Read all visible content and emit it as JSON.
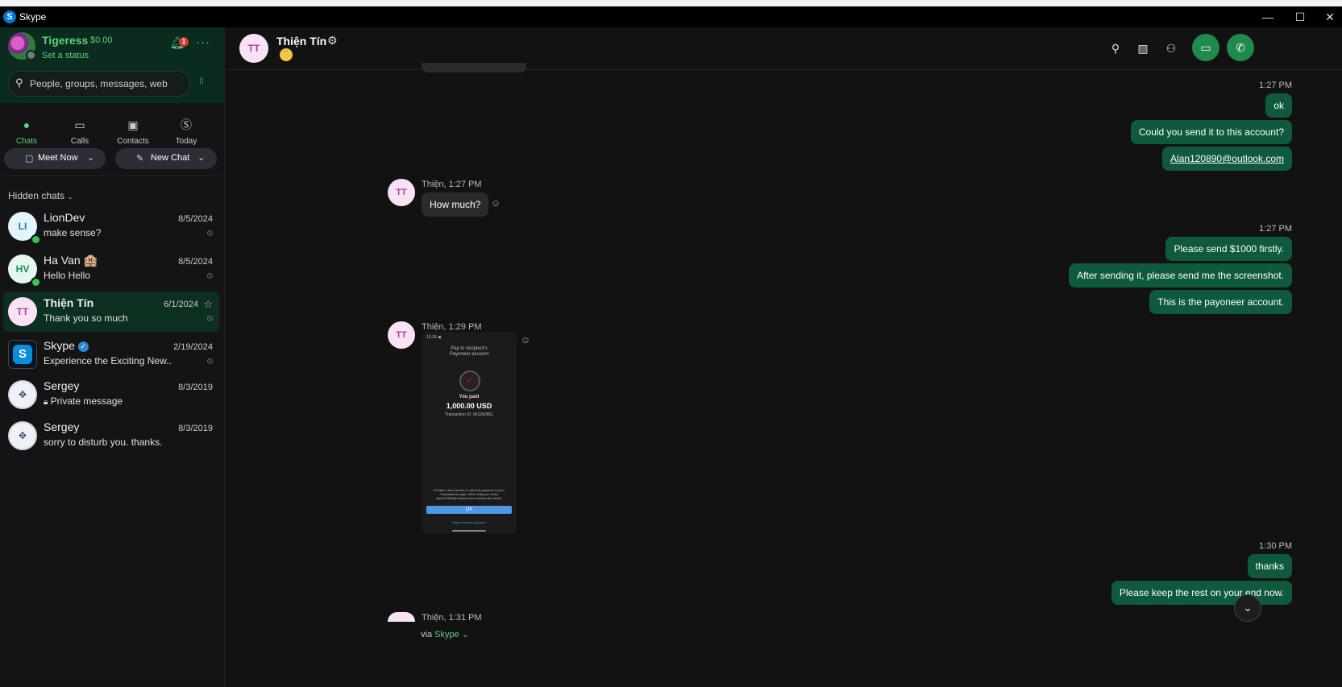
{
  "window": {
    "title": "Skype",
    "minimize": "—",
    "maximize": "☐",
    "close": "✕"
  },
  "profile": {
    "name": "Tigeress",
    "credit": "$0.00",
    "status": "Set a status",
    "notifications": "1"
  },
  "search": {
    "placeholder": "People, groups, messages, web"
  },
  "nav": {
    "chats": "Chats",
    "calls": "Calls",
    "contacts": "Contacts",
    "today": "Today"
  },
  "actions": {
    "meet_now": "Meet Now",
    "new_chat": "New Chat"
  },
  "hidden_chats_label": "Hidden chats",
  "chats": [
    {
      "initials": "LI",
      "name": "LionDev",
      "preview": "make sense?",
      "date": "8/5/2024"
    },
    {
      "initials": "HV",
      "name": "Ha Van 🏨",
      "preview": "Hello Hello",
      "date": "8/5/2024"
    },
    {
      "initials": "TT",
      "name": "Thiện Tín",
      "preview": "Thank you so much",
      "date": "6/1/2024"
    },
    {
      "initials": "S",
      "name": "Skype",
      "preview": "Experience the Exciting New...",
      "date": "2/19/2024"
    },
    {
      "initials": "",
      "name": "Sergey",
      "preview": "Private message",
      "date": "8/3/2019"
    },
    {
      "initials": "",
      "name": "Sergey",
      "preview": "sorry to disturb you. thanks.",
      "date": "8/3/2019"
    }
  ],
  "conversation": {
    "initials": "TT",
    "name": "Thiện Tín",
    "groups": [
      {
        "time": "1:27 PM",
        "messages": [
          "ok",
          "Could you send it to this account?",
          "Alan120890@outlook.com"
        ]
      },
      {
        "sender_time": "Thiện, 1:27 PM",
        "message": "How much?"
      },
      {
        "time": "1:27 PM",
        "messages": [
          "Please send $1000 firstly.",
          "After sending it, please send me the screenshot.",
          "This is the payoneer account."
        ]
      },
      {
        "sender_time": "Thiện, 1:29 PM"
      },
      {
        "time": "1:30 PM",
        "messages": [
          "thanks",
          "Please keep the rest on your end now."
        ]
      },
      {
        "sender_time": "Thiện, 1:31 PM"
      }
    ],
    "attachment": {
      "status_time": "15:39 ◀",
      "title_line1": "Pay to recipient's",
      "title_line2": "Payoneer account",
      "paid_label": "You paid",
      "amount": "1,000.00 USD",
      "transaction": "Transaction ID: 661260651",
      "note": "It'll take a few minutes to see this payment in your Transactions page. We'll notify you when alan120890@outlook.com receives the funds.",
      "ok": "OK",
      "another": "Make another payment"
    },
    "via_prefix": "via",
    "via_app": "Skype"
  }
}
